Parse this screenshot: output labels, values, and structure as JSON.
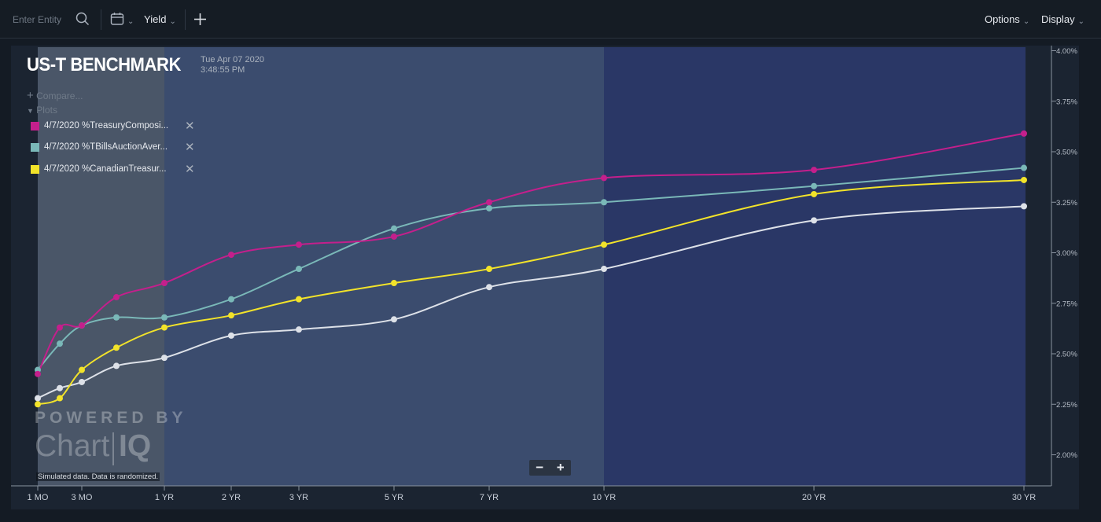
{
  "toolbar": {
    "entity_placeholder": "Enter Entity",
    "search_icon": "search-icon",
    "calendar_icon": "calendar-icon",
    "yield_label": "Yield",
    "add_icon": "plus-icon",
    "options_label": "Options",
    "display_label": "Display"
  },
  "header": {
    "title": "US-T BENCHMARK",
    "date": "Tue Apr 07 2020",
    "time": "3:48:55 PM"
  },
  "panel": {
    "compare_label": "Compare...",
    "plots_label": "Plots"
  },
  "legend": [
    {
      "label": "4/7/2020 %TreasuryComposi...",
      "color": "#c41f8c"
    },
    {
      "label": "4/7/2020 %TBillsAuctionAver...",
      "color": "#7ab8b8"
    },
    {
      "label": "4/7/2020 %CanadianTreasur...",
      "color": "#f2e32a"
    }
  ],
  "watermark": {
    "powered_by": "POWERED BY",
    "brand": "Chart",
    "brand_suffix": "IQ"
  },
  "disclaimer": "Simulated data.  Data is randomized.",
  "zoom": {
    "minus": "−",
    "plus": "+"
  },
  "chart_data": {
    "type": "line",
    "x_labels": [
      "1 MO",
      "3 MO",
      "1 YR",
      "2 YR",
      "3 YR",
      "5 YR",
      "7 YR",
      "10 YR",
      "20 YR",
      "30 YR"
    ],
    "y_ticks": [
      "2.00%",
      "2.25%",
      "2.50%",
      "2.75%",
      "3.00%",
      "3.25%",
      "3.50%",
      "3.75%",
      "4.00%"
    ],
    "ylim": [
      2.0,
      4.0
    ],
    "tenors": [
      0.083,
      0.167,
      0.25,
      0.5,
      1,
      2,
      3,
      5,
      7,
      10,
      20,
      30
    ],
    "series": [
      {
        "name": "4/7/2020 %TreasuryComposi...",
        "color": "#c41f8c",
        "values": [
          2.4,
          2.63,
          2.64,
          2.78,
          2.85,
          2.99,
          3.04,
          3.08,
          3.25,
          3.37,
          3.41,
          3.59
        ]
      },
      {
        "name": "4/7/2020 %TBillsAuctionAver...",
        "color": "#7ab8b8",
        "values": [
          2.42,
          2.55,
          2.64,
          2.68,
          2.68,
          2.77,
          2.92,
          3.12,
          3.22,
          3.25,
          3.33,
          3.42
        ]
      },
      {
        "name": "4/7/2020 %CanadianTreasur...",
        "color": "#f2e32a",
        "values": [
          2.25,
          2.28,
          2.42,
          2.53,
          2.63,
          2.69,
          2.77,
          2.85,
          2.92,
          3.04,
          3.29,
          3.36
        ]
      },
      {
        "color": "#dde1e8",
        "values": [
          2.28,
          2.33,
          2.36,
          2.44,
          2.48,
          2.59,
          2.62,
          2.67,
          2.83,
          2.92,
          3.16,
          3.23
        ]
      }
    ],
    "grid": false
  }
}
